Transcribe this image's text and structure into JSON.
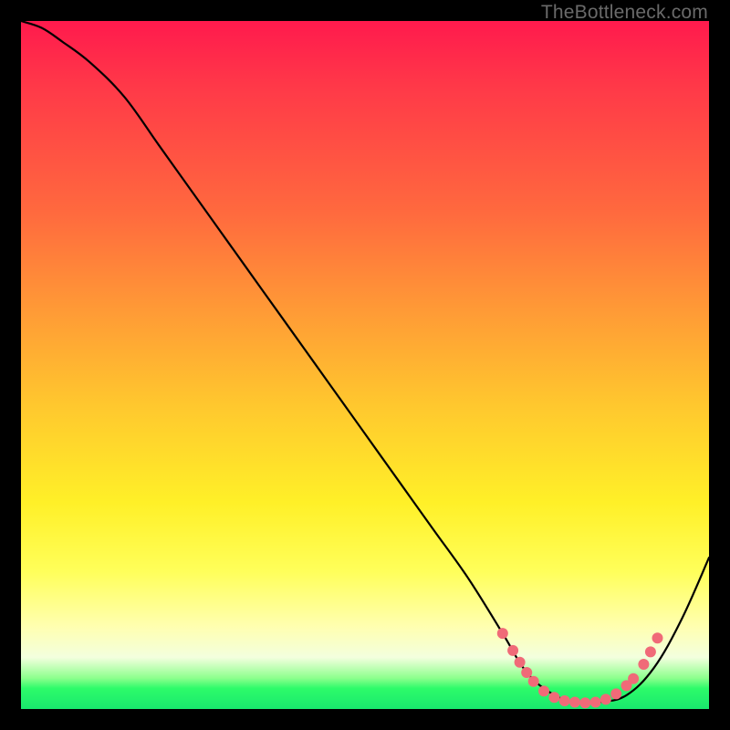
{
  "attribution": "TheBottleneck.com",
  "colors": {
    "frame": "#000000",
    "curve": "#000000",
    "dot": "#f06a78",
    "gradient_stops": [
      "#ff1a4d",
      "#ff3a48",
      "#ff6a3e",
      "#ff9a36",
      "#ffc82e",
      "#fff028",
      "#ffff5a",
      "#ffffb0",
      "#f3ffde",
      "#8dff8d",
      "#2dfb6a",
      "#19e86d"
    ]
  },
  "chart_data": {
    "type": "line",
    "title": "",
    "xlabel": "",
    "ylabel": "",
    "xlim": [
      0,
      100
    ],
    "ylim": [
      0,
      100
    ],
    "grid": false,
    "legend": false,
    "series": [
      {
        "name": "bottleneck-curve",
        "x": [
          0,
          3,
          6,
          10,
          15,
          20,
          25,
          30,
          35,
          40,
          45,
          50,
          55,
          60,
          65,
          70,
          73,
          76,
          80,
          84,
          88,
          92,
          96,
          100
        ],
        "y": [
          100,
          99,
          97,
          94,
          89,
          82,
          75,
          68,
          61,
          54,
          47,
          40,
          33,
          26,
          19,
          11,
          6,
          3,
          1,
          1,
          2,
          6,
          13,
          22
        ]
      }
    ],
    "markers": [
      {
        "x": 70.0,
        "y": 11.0
      },
      {
        "x": 71.5,
        "y": 8.5
      },
      {
        "x": 72.5,
        "y": 6.8
      },
      {
        "x": 73.5,
        "y": 5.3
      },
      {
        "x": 74.5,
        "y": 4.0
      },
      {
        "x": 76.0,
        "y": 2.6
      },
      {
        "x": 77.5,
        "y": 1.7
      },
      {
        "x": 79.0,
        "y": 1.2
      },
      {
        "x": 80.5,
        "y": 1.0
      },
      {
        "x": 82.0,
        "y": 0.9
      },
      {
        "x": 83.5,
        "y": 1.0
      },
      {
        "x": 85.0,
        "y": 1.4
      },
      {
        "x": 86.5,
        "y": 2.2
      },
      {
        "x": 88.0,
        "y": 3.4
      },
      {
        "x": 89.0,
        "y": 4.4
      },
      {
        "x": 90.5,
        "y": 6.5
      },
      {
        "x": 91.5,
        "y": 8.3
      },
      {
        "x": 92.5,
        "y": 10.3
      }
    ],
    "dot_radius_px": 6
  }
}
